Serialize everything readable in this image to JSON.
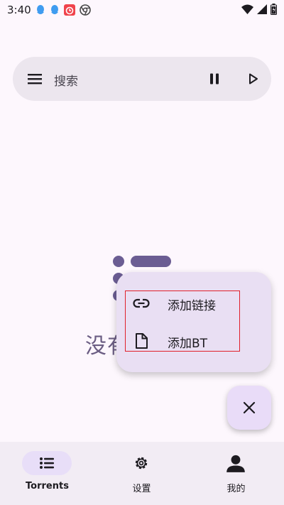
{
  "status_bar": {
    "time": "3:40",
    "notification_icons": [
      "qq-icon",
      "qq-icon",
      "alarm-app-icon",
      "chrome-icon"
    ],
    "system_icons": [
      "wifi-icon",
      "signal-icon",
      "battery-icon"
    ]
  },
  "search": {
    "label": "搜索"
  },
  "empty_state": {
    "text": "没有"
  },
  "fab_menu": {
    "items": [
      {
        "label": "添加链接",
        "icon": "link-icon"
      },
      {
        "label": "添加BT",
        "icon": "file-icon"
      }
    ]
  },
  "bottom_nav": {
    "items": [
      {
        "label": "Torrents",
        "icon": "list-icon",
        "active": true
      },
      {
        "label": "设置",
        "icon": "gear-icon",
        "active": false
      },
      {
        "label": "我的",
        "icon": "person-icon",
        "active": false
      }
    ]
  },
  "colors": {
    "background": "#fdf7fd",
    "search_bar": "#ece6ee",
    "menu_surface": "#e9dff3",
    "accent": "#6b5d93",
    "highlight": "#e0202a"
  }
}
